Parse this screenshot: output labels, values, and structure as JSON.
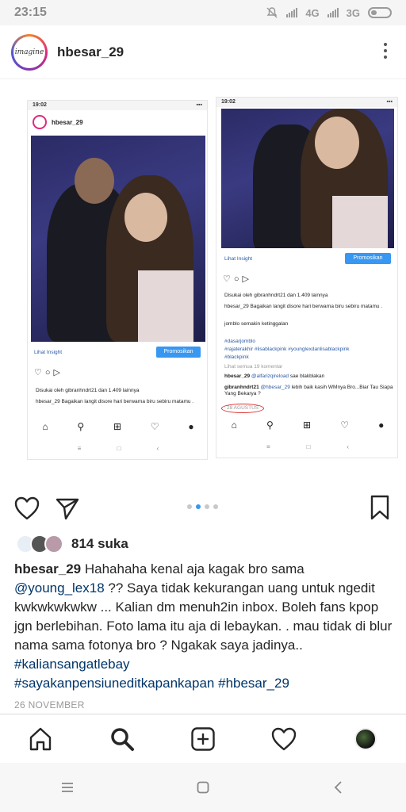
{
  "status_bar": {
    "time": "23:15",
    "network_1": "4G",
    "network_2": "3G"
  },
  "post": {
    "username": "hbesar_29",
    "avatar_text": "imagine",
    "likes": "814 suka",
    "caption_user": "hbesar_29",
    "caption_part1": " Hahahaha kenal aja kagak bro sama ",
    "caption_mention": "@young_lex18",
    "caption_part2": " ?? Saya tidak kekurangan uang untuk ngedit kwkwkwkwkw ... Kalian dm menuh2in inbox. Boleh fans kpop jgn berlebihan. Foto lama itu aja di lebaykan. . mau tidak di blur nama sama fotonya bro ? Ngakak saya jadinya.. ",
    "caption_tag1": "#kaliansangatlebay",
    "caption_tag2": "#sayakanpensiuneditkapankapan",
    "caption_tag3": "#hbesar_29",
    "date": "26 NOVEMBER"
  },
  "screenshot_left": {
    "time": "19:02",
    "username": "hbesar_29",
    "insight": "Lihat Insight",
    "promote": "Promosikan",
    "liked_by": "Disukai oleh gibranhndrt21 dan 1.409 lainnya",
    "caption": "hbesar_29 Bagaikan langit disore hari berwarna biru sebiru matamu ."
  },
  "screenshot_right": {
    "time": "19:02",
    "insight": "Lihat Insight",
    "promote": "Promosikan",
    "liked_by": "Disukai oleh gibranhndrt21 dan 1.409 lainnya",
    "caption": "hbesar_29 Bagaikan langit disore hari berwarna biru sebiru matamu .",
    "line2": "jomblo semakin ketinggalan",
    "tag_line1": "#dasarjomblo",
    "tag_line2": "#rajaterakhir #lisablackpink #younglexdanlisablackpink",
    "tag_line3": "#blackpink",
    "view_comments": "Lihat semua 19 komentar",
    "comment1_user": "hbesar_29",
    "comment1_mention": "@alfarizqireload",
    "comment1_text": "sae blakblakan",
    "comment2_user": "gibranhndrt21",
    "comment2_mention": "@hbesar_29",
    "comment2_text": "lebih baik kasih WMnya Bro...Biar Tau Siapa Yang Bekarya ?",
    "date": "28 AGUSTUS"
  },
  "colors": {
    "accent": "#3897f0",
    "link": "#003569"
  }
}
